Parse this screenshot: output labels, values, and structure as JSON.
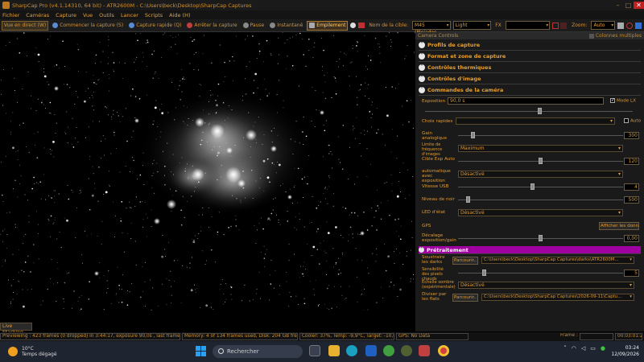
{
  "window": {
    "title": "SharpCap Pro (v4.1.14310, 64 bit) - ATR2600M - C:\\Users\\beck\\Desktop\\SharpCap Captures"
  },
  "menu": [
    "Fichier",
    "Caméras",
    "Capture",
    "Vue",
    "Outils",
    "Lancer",
    "Scripts",
    "Aide (H)"
  ],
  "toolbar": {
    "live_view": "Vue en direct (W)",
    "start_capture": "Commencer la capture (S)",
    "quick_capture": "Capture rapide (Q)",
    "stop_capture": "Arrêter la capture",
    "pause": "Pause",
    "snapshot": "Instantané",
    "stacking": "Empilement",
    "target_label": "Nom de la cible:",
    "target_value": "M45 (Pleiades,",
    "frame_type": "Light",
    "fx_label": "FX",
    "fx_value": "",
    "zoom_label": "Zoom:",
    "zoom_value": "Auto"
  },
  "panel": {
    "title": "Camera Controls",
    "multi_columns": "Colonnes multiples",
    "sections": {
      "profiles": "Profils de capture",
      "format": "Format et zone de capture",
      "thermal": "Contrôles thermiques",
      "image": "Contrôles d'image",
      "camera": "Commandes de la caméra",
      "preprocessing": "Prétraitement"
    },
    "exposure": {
      "label": "Exposition",
      "value": "90,0 s",
      "mode_lx": "Mode LX"
    },
    "quick_choices": {
      "label": "Choix rapides",
      "value": "",
      "auto": "Auto"
    },
    "gain": {
      "label": "Gain analogique",
      "value": "300",
      "fraction": 0.08
    },
    "frame_rate_limit": {
      "label": "Limite de fréquence d'images",
      "value": "Maximum"
    },
    "target_auto_exp": {
      "label": "Cible Exp Auto",
      "value": "120",
      "fraction": 0.5
    },
    "auto_exposure": {
      "label": "automatique avec exposition",
      "value": "Désactivé"
    },
    "usb_speed": {
      "label": "Vitesse USB",
      "value": "4",
      "fraction": 0.45
    },
    "black_level": {
      "label": "Niveau de noir",
      "value": "500",
      "fraction": 0.05
    },
    "status_led": {
      "label": "LED d'état",
      "value": "Désactivé"
    },
    "gps": {
      "label": "GPS",
      "button": "Afficher les donn"
    },
    "exp_gain_offset": {
      "label": "Décalage exposition/gain",
      "value": "0,00",
      "fraction": 0.5
    },
    "subtract_darks": {
      "label": "Soustraire les darks",
      "button": "Parcourir..",
      "path": "C:\\Users\\beck\\Desktop\\SharpCap Captures\\darks\\ATR2600M..."
    },
    "hot_pixel": {
      "label": "Sensibilité des pixels chauds",
      "value": "5",
      "fraction": 0.15
    },
    "dark_scaling": {
      "label": "Échelle sombre (expérimentale)",
      "value": "Désactivé"
    },
    "divide_flats": {
      "label": "Diviser par les flats",
      "button": "Parcourir..",
      "path": "C:\\Users\\beck\\Desktop\\SharpCap Captures\\2026-09-11\\Captu..."
    }
  },
  "live_stacking": "Live Stacking",
  "status": {
    "previewing": "Previewing : 423 frames (0 dropped) in 3:44:17, exposure 90,0s , last frame 90,0s",
    "memory": "Memory: 4 of 134 frames used, Disk: 204 GB free",
    "cooler": "Cooler: 37%, Temp: -9,9°C, Target: -10,0°C",
    "gps": "GPS: No Data",
    "frame_label": "Frame :",
    "frame_time": "00:03:01:27"
  },
  "taskbar": {
    "temperature": "10°C",
    "weather": "Temps dégagé",
    "search": "Rechercher",
    "time": "03:24",
    "date": "12/09/2026"
  },
  "colors": {
    "accent": "#e8a030",
    "preprocessing_bar": "#a000a0",
    "background": "#000000"
  }
}
